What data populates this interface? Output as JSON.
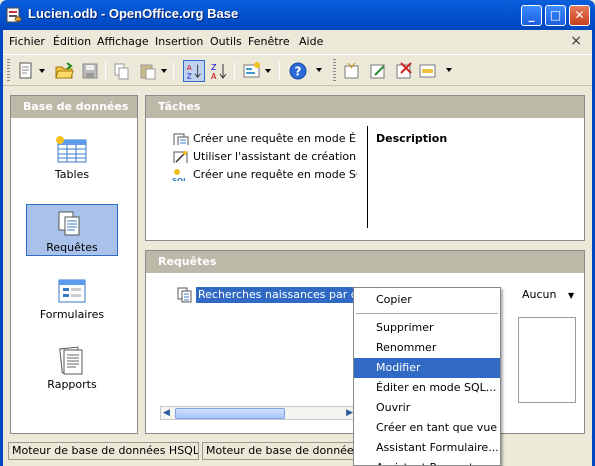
{
  "window": {
    "title": "Lucien.odb - OpenOffice.org Base",
    "buttons": {
      "minimize": "_",
      "maximize": "□",
      "close": "✕"
    }
  },
  "menu": {
    "items": [
      "Fichier",
      "Édition",
      "Affichage",
      "Insertion",
      "Outils",
      "Fenêtre",
      "Aide"
    ],
    "doc_close": "×"
  },
  "toolbar": {
    "icons": [
      "new-document-icon",
      "open-folder-icon",
      "save-icon",
      "copy-icon",
      "paste-icon",
      "sort-ascending-icon",
      "sort-descending-icon",
      "form-icon",
      "help-icon",
      "new-form-icon",
      "edit-icon",
      "delete-icon",
      "rename-icon"
    ]
  },
  "left_pane": {
    "title": "Base de données",
    "items": [
      {
        "label": "Tables",
        "selected": false
      },
      {
        "label": "Requêtes",
        "selected": true
      },
      {
        "label": "Formulaires",
        "selected": false
      },
      {
        "label": "Rapports",
        "selected": false
      }
    ]
  },
  "tasks": {
    "title": "Tâches",
    "items": [
      "Créer une requête en mode Ébauche...",
      "Utiliser l'assistant de création de requête...",
      "Créer une requête en mode SQL..."
    ],
    "description_title": "Description"
  },
  "queries": {
    "title": "Requêtes",
    "items": [
      "Recherches naissances par département"
    ],
    "preview_option": "Aucun"
  },
  "status": {
    "cells": [
      "Moteur de base de données HSQL",
      "Moteur de base de données HSQL"
    ]
  },
  "context_menu": {
    "items": [
      "Copier",
      "Supprimer",
      "Renommer",
      "Modifier",
      "Éditer en mode SQL...",
      "Ouvrir",
      "Créer en tant que vue",
      "Assistant Formulaire...",
      "Assistant Rapport..."
    ],
    "highlighted": "Modifier"
  },
  "colors": {
    "title_bar": "#0554d0",
    "selection": "#316ac5",
    "pane_header": "#bdb9a9"
  }
}
